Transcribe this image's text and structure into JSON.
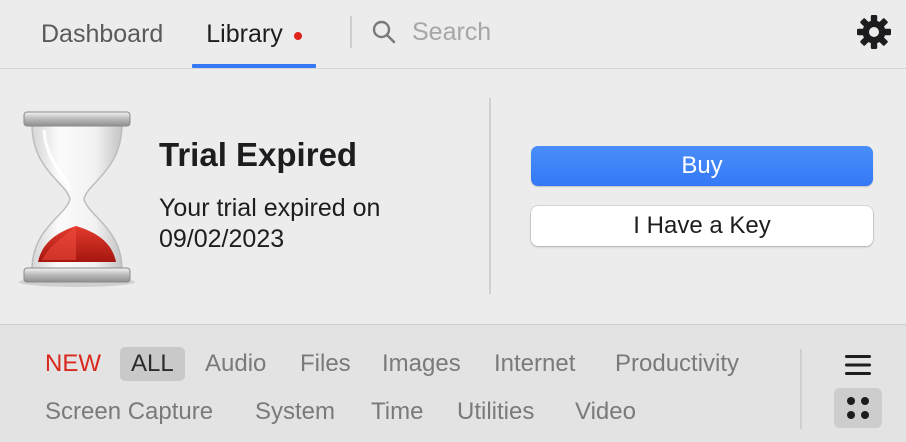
{
  "tabs": {
    "dashboard": "Dashboard",
    "library": "Library"
  },
  "search": {
    "placeholder": "Search"
  },
  "trial": {
    "title": "Trial Expired",
    "message": "Your trial expired on 09/02/2023",
    "buy_label": "Buy",
    "key_label": "I Have a Key"
  },
  "categories": {
    "new": "NEW",
    "all": "ALL",
    "audio": "Audio",
    "files": "Files",
    "images": "Images",
    "internet": "Internet",
    "productivity": "Productivity",
    "screen_capture": "Screen Capture",
    "system": "System",
    "time": "Time",
    "utilities": "Utilities",
    "video": "Video"
  },
  "icons": {
    "search": "search-icon",
    "settings": "gear-icon",
    "trial": "hourglass-icon",
    "list_view": "list-view-icon",
    "grid_view": "grid-view-icon"
  },
  "colors": {
    "accent": "#3478f6",
    "notification_dot": "#e0241b",
    "new_label": "#d9281e",
    "sand": "#d9281e"
  }
}
